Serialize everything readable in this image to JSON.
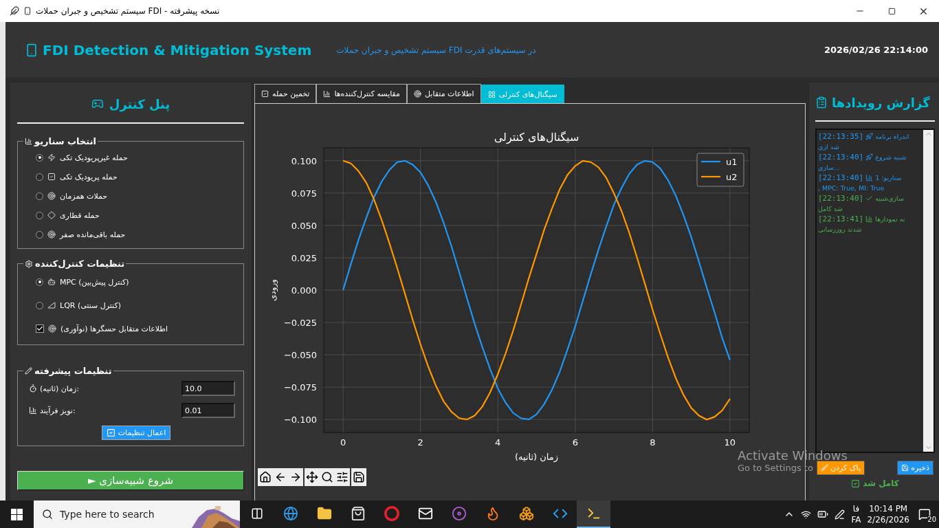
{
  "window": {
    "title": "نسخه پیشرفته - FDI سیستم تشخیص و جبران حملات"
  },
  "header": {
    "title": "FDI Detection & Mitigation System",
    "subtitle": "در سیستم‌های قدرت FDI سیستم تشخیص و جبران حملات",
    "datetime": "2026/02/26 22:14:00"
  },
  "control_panel": {
    "title": "پنل کنترل",
    "scenario_group": {
      "title": "انتخاب سناریو",
      "options": [
        {
          "label": "حمله غیرپریودیک تکی",
          "selected": true
        },
        {
          "label": "حمله پریودیک تکی",
          "selected": false
        },
        {
          "label": "حملات همزمان",
          "selected": false
        },
        {
          "label": "حمله قطاری",
          "selected": false
        },
        {
          "label": "حمله باقی‌مانده صفر",
          "selected": false
        }
      ]
    },
    "controller_group": {
      "title": "تنظیمات کنترل‌کننده",
      "options": [
        {
          "kind": "radio",
          "label": "MPC (کنترل پیش‌بین)",
          "selected": true
        },
        {
          "kind": "radio",
          "label": "LQR (کنترل سنتی)",
          "selected": false
        },
        {
          "kind": "checkbox",
          "label": "اطلاعات متقابل حسگرها (نوآوری)",
          "checked": true
        }
      ]
    },
    "advanced_group": {
      "title": "تنظیمات پیشرفته",
      "fields": [
        {
          "label": "زمان (ثانیه):",
          "value": "10.0"
        },
        {
          "label": "نویز فرآیند:",
          "value": "0.01"
        }
      ],
      "apply_button": "اعمال تنظیمات"
    },
    "start_button": "► شروع شبیه‌سازی"
  },
  "tabs": [
    {
      "label": "سیگنال‌های کنترلی",
      "selected": true
    },
    {
      "label": "اطلاعات متقابل",
      "selected": false
    },
    {
      "label": "مقایسه کنترل‌کننده‌ها",
      "selected": false
    },
    {
      "label": "تخمین حمله",
      "selected": false
    }
  ],
  "chart": {
    "chart_data": {
      "type": "line",
      "title": "سیگنال‌های کنترلی",
      "xlabel": "زمان (ثانیه)",
      "ylabel": "ورودی",
      "x": [
        0,
        0.2,
        0.4,
        0.6,
        0.8,
        1,
        1.2,
        1.4,
        1.6,
        1.8,
        2,
        2.2,
        2.4,
        2.6,
        2.8,
        3,
        3.2,
        3.4,
        3.6,
        3.8,
        4,
        4.2,
        4.4,
        4.6,
        4.8,
        5,
        5.2,
        5.4,
        5.6,
        5.8,
        6,
        6.2,
        6.4,
        6.6,
        6.8,
        7,
        7.2,
        7.4,
        7.6,
        7.8,
        8,
        8.2,
        8.4,
        8.6,
        8.8,
        9,
        9.2,
        9.4,
        9.6,
        9.8,
        10
      ],
      "series": [
        {
          "name": "u1",
          "color": "#2196f3",
          "values": [
            0,
            0.02,
            0.039,
            0.056,
            0.072,
            0.084,
            0.093,
            0.099,
            0.1,
            0.097,
            0.091,
            0.081,
            0.068,
            0.052,
            0.034,
            0.014,
            -0.006,
            -0.026,
            -0.044,
            -0.061,
            -0.076,
            -0.087,
            -0.095,
            -0.099,
            -0.1,
            -0.096,
            -0.088,
            -0.077,
            -0.063,
            -0.046,
            -0.028,
            -0.008,
            0.012,
            0.031,
            0.049,
            0.066,
            0.079,
            0.09,
            0.097,
            0.1,
            0.099,
            0.094,
            0.085,
            0.073,
            0.058,
            0.041,
            0.022,
            0.002,
            -0.017,
            -0.037,
            -0.054
          ]
        },
        {
          "name": "u2",
          "color": "#ff9800",
          "values": [
            0.1,
            0.098,
            0.092,
            0.083,
            0.07,
            0.054,
            0.036,
            0.017,
            -0.003,
            -0.023,
            -0.042,
            -0.059,
            -0.074,
            -0.086,
            -0.094,
            -0.099,
            -0.1,
            -0.097,
            -0.09,
            -0.079,
            -0.065,
            -0.049,
            -0.031,
            -0.011,
            0.009,
            0.028,
            0.047,
            0.063,
            0.078,
            0.089,
            0.096,
            0.1,
            0.099,
            0.095,
            0.087,
            0.075,
            0.061,
            0.044,
            0.025,
            0.005,
            -0.015,
            -0.034,
            -0.052,
            -0.068,
            -0.081,
            -0.091,
            -0.097,
            -0.1,
            -0.098,
            -0.093,
            -0.084
          ]
        }
      ],
      "xlim": [
        -0.5,
        10.5
      ],
      "ylim": [
        -0.11,
        0.11
      ],
      "grid": true,
      "legend": true,
      "xticks": [
        0,
        2,
        4,
        6,
        8,
        10
      ],
      "yticks": [
        {
          "value": -0.1,
          "label": "−0.100"
        },
        {
          "value": -0.075,
          "label": "−0.075"
        },
        {
          "value": -0.05,
          "label": "−0.050"
        },
        {
          "value": -0.025,
          "label": "−0.025"
        },
        {
          "value": 0,
          "label": "0.000"
        },
        {
          "value": 0.025,
          "label": "0.025"
        },
        {
          "value": 0.05,
          "label": "0.050"
        },
        {
          "value": 0.075,
          "label": "0.075"
        },
        {
          "value": 0.1,
          "label": "0.100"
        }
      ]
    }
  },
  "event_log": {
    "title": "گزارش رویدادها",
    "entries": [
      {
        "kind": "info",
        "time": "[22:13:35]",
        "lines": [
          "اندراه برنامه",
          "شد ازی"
        ]
      },
      {
        "kind": "info",
        "time": "[22:13:40]",
        "lines": [
          "شبیه شروع",
          "سازی..."
        ]
      },
      {
        "kind": "info",
        "time": "[22:13:40]",
        "lines": [
          "سناریو: 1",
          ", MPC: True, MI: True"
        ]
      },
      {
        "kind": "success",
        "time": "[22:13:40]",
        "lines": [
          "سازی‌شبیه",
          "شد کامل"
        ]
      },
      {
        "kind": "success",
        "time": "[22:13:41]",
        "lines": [
          "به نمودارها",
          "شدند روزرسانی"
        ]
      }
    ],
    "clear_button": "پاک کردن",
    "save_button": "ذخیره",
    "status": "کامل شد"
  },
  "activation_notice": {
    "title": "Activate Windows",
    "text": "Go to Settings to"
  },
  "taskbar": {
    "search_placeholder": "Type here to search",
    "language_short": "فا",
    "language_code": "FA",
    "time": "10:14 PM",
    "date": "2/26/2026",
    "notifications": "20"
  }
}
